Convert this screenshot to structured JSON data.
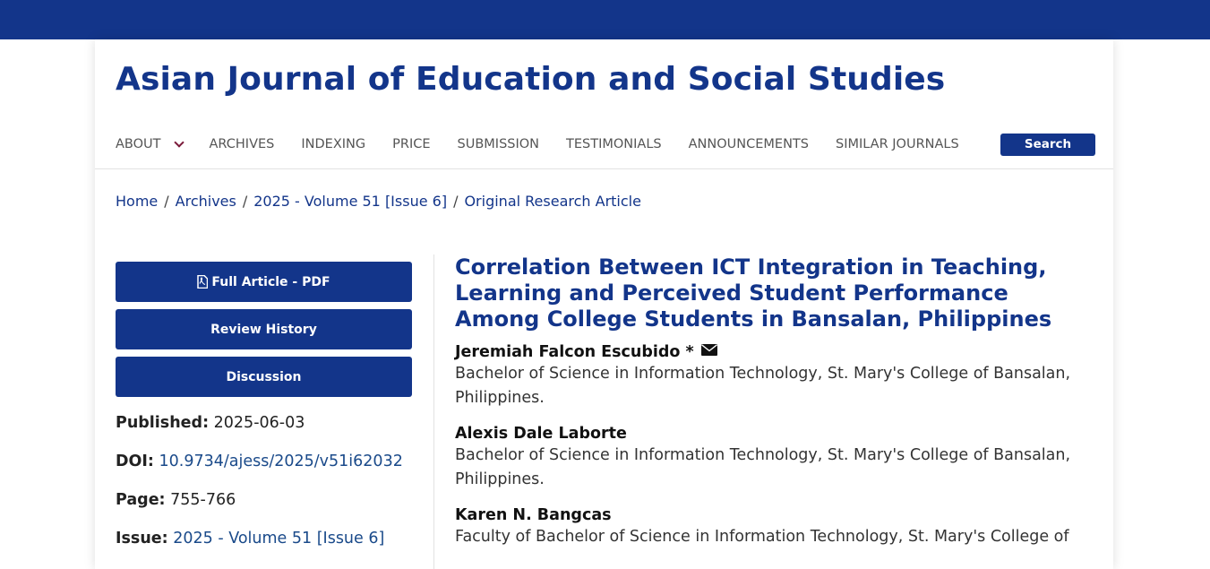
{
  "site": {
    "title": "Asian Journal of Education and Social Studies",
    "brand_color": "#13358a"
  },
  "nav": {
    "items": [
      {
        "label": "About",
        "has_dropdown": true
      },
      {
        "label": "Archives"
      },
      {
        "label": "Indexing"
      },
      {
        "label": "Price"
      },
      {
        "label": "Submission"
      },
      {
        "label": "Testimonials"
      },
      {
        "label": "Announcements"
      },
      {
        "label": "Similar Journals"
      }
    ],
    "search_label": "Search"
  },
  "breadcrumb": [
    "Home",
    "Archives",
    "2025 - Volume 51 [Issue 6]",
    "Original Research Article"
  ],
  "sidebar": {
    "buttons": {
      "full_article": "Full Article - PDF",
      "review_history": "Review History",
      "discussion": "Discussion"
    },
    "meta": {
      "published_label": "Published:",
      "published_value": "2025-06-03",
      "doi_label": "DOI:",
      "doi_value": "10.9734/ajess/2025/v51i62032",
      "page_label": "Page:",
      "page_value": "755-766",
      "issue_label": "Issue:",
      "issue_value": "2025 - Volume 51 [Issue 6]"
    }
  },
  "article": {
    "title": "Correlation Between ICT Integration in Teaching, Learning and Perceived Student Performance Among College Students in Bansalan, Philippines",
    "authors": [
      {
        "name": "Jeremiah Falcon Escubido *",
        "affiliation": "Bachelor of Science in Information Technology, St. Mary's College of Bansalan, Philippines.",
        "icon": "envelope-icon"
      },
      {
        "name": "Alexis Dale Laborte",
        "affiliation": "Bachelor of Science in Information Technology, St. Mary's College of Bansalan, Philippines."
      },
      {
        "name": "Karen N. Bangcas",
        "affiliation": "Faculty of Bachelor of Science in Information Technology, St. Mary's College of"
      }
    ]
  }
}
